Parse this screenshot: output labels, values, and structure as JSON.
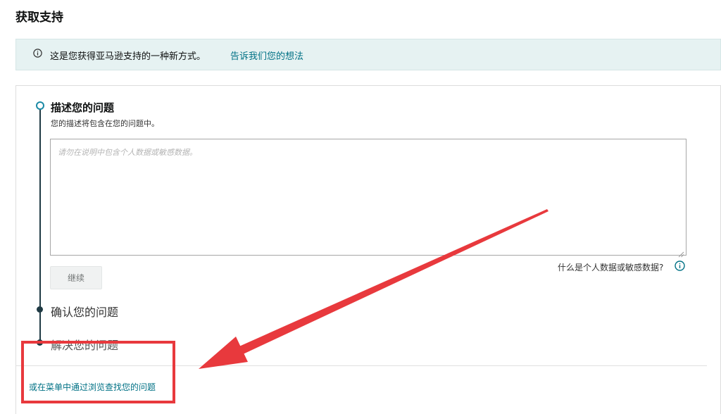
{
  "page": {
    "title": "获取支持"
  },
  "banner": {
    "text": "这是您获得亚马逊支持的一种新方式。",
    "link": "告诉我们您的想法",
    "icon": "info-icon"
  },
  "steps": [
    {
      "title": "描述您的问题",
      "description": "您的描述将包含在您的问题中。",
      "placeholder": "请勿在说明中包含个人数据或敏感数据。",
      "continue_label": "继续",
      "help_text": "什么是个人数据或敏感数据?",
      "active": true
    },
    {
      "title": "确认您的问题",
      "active": false
    },
    {
      "title": "解决您的问题",
      "active": false
    }
  ],
  "footer": {
    "browse_link": "或在菜单中通过浏览查找您的问题"
  },
  "colors": {
    "link": "#007185",
    "banner_bg": "#e6f2f2",
    "timeline": "#1f3a44",
    "active_step": "#1b8aa6",
    "annotation": "#e8393d"
  }
}
